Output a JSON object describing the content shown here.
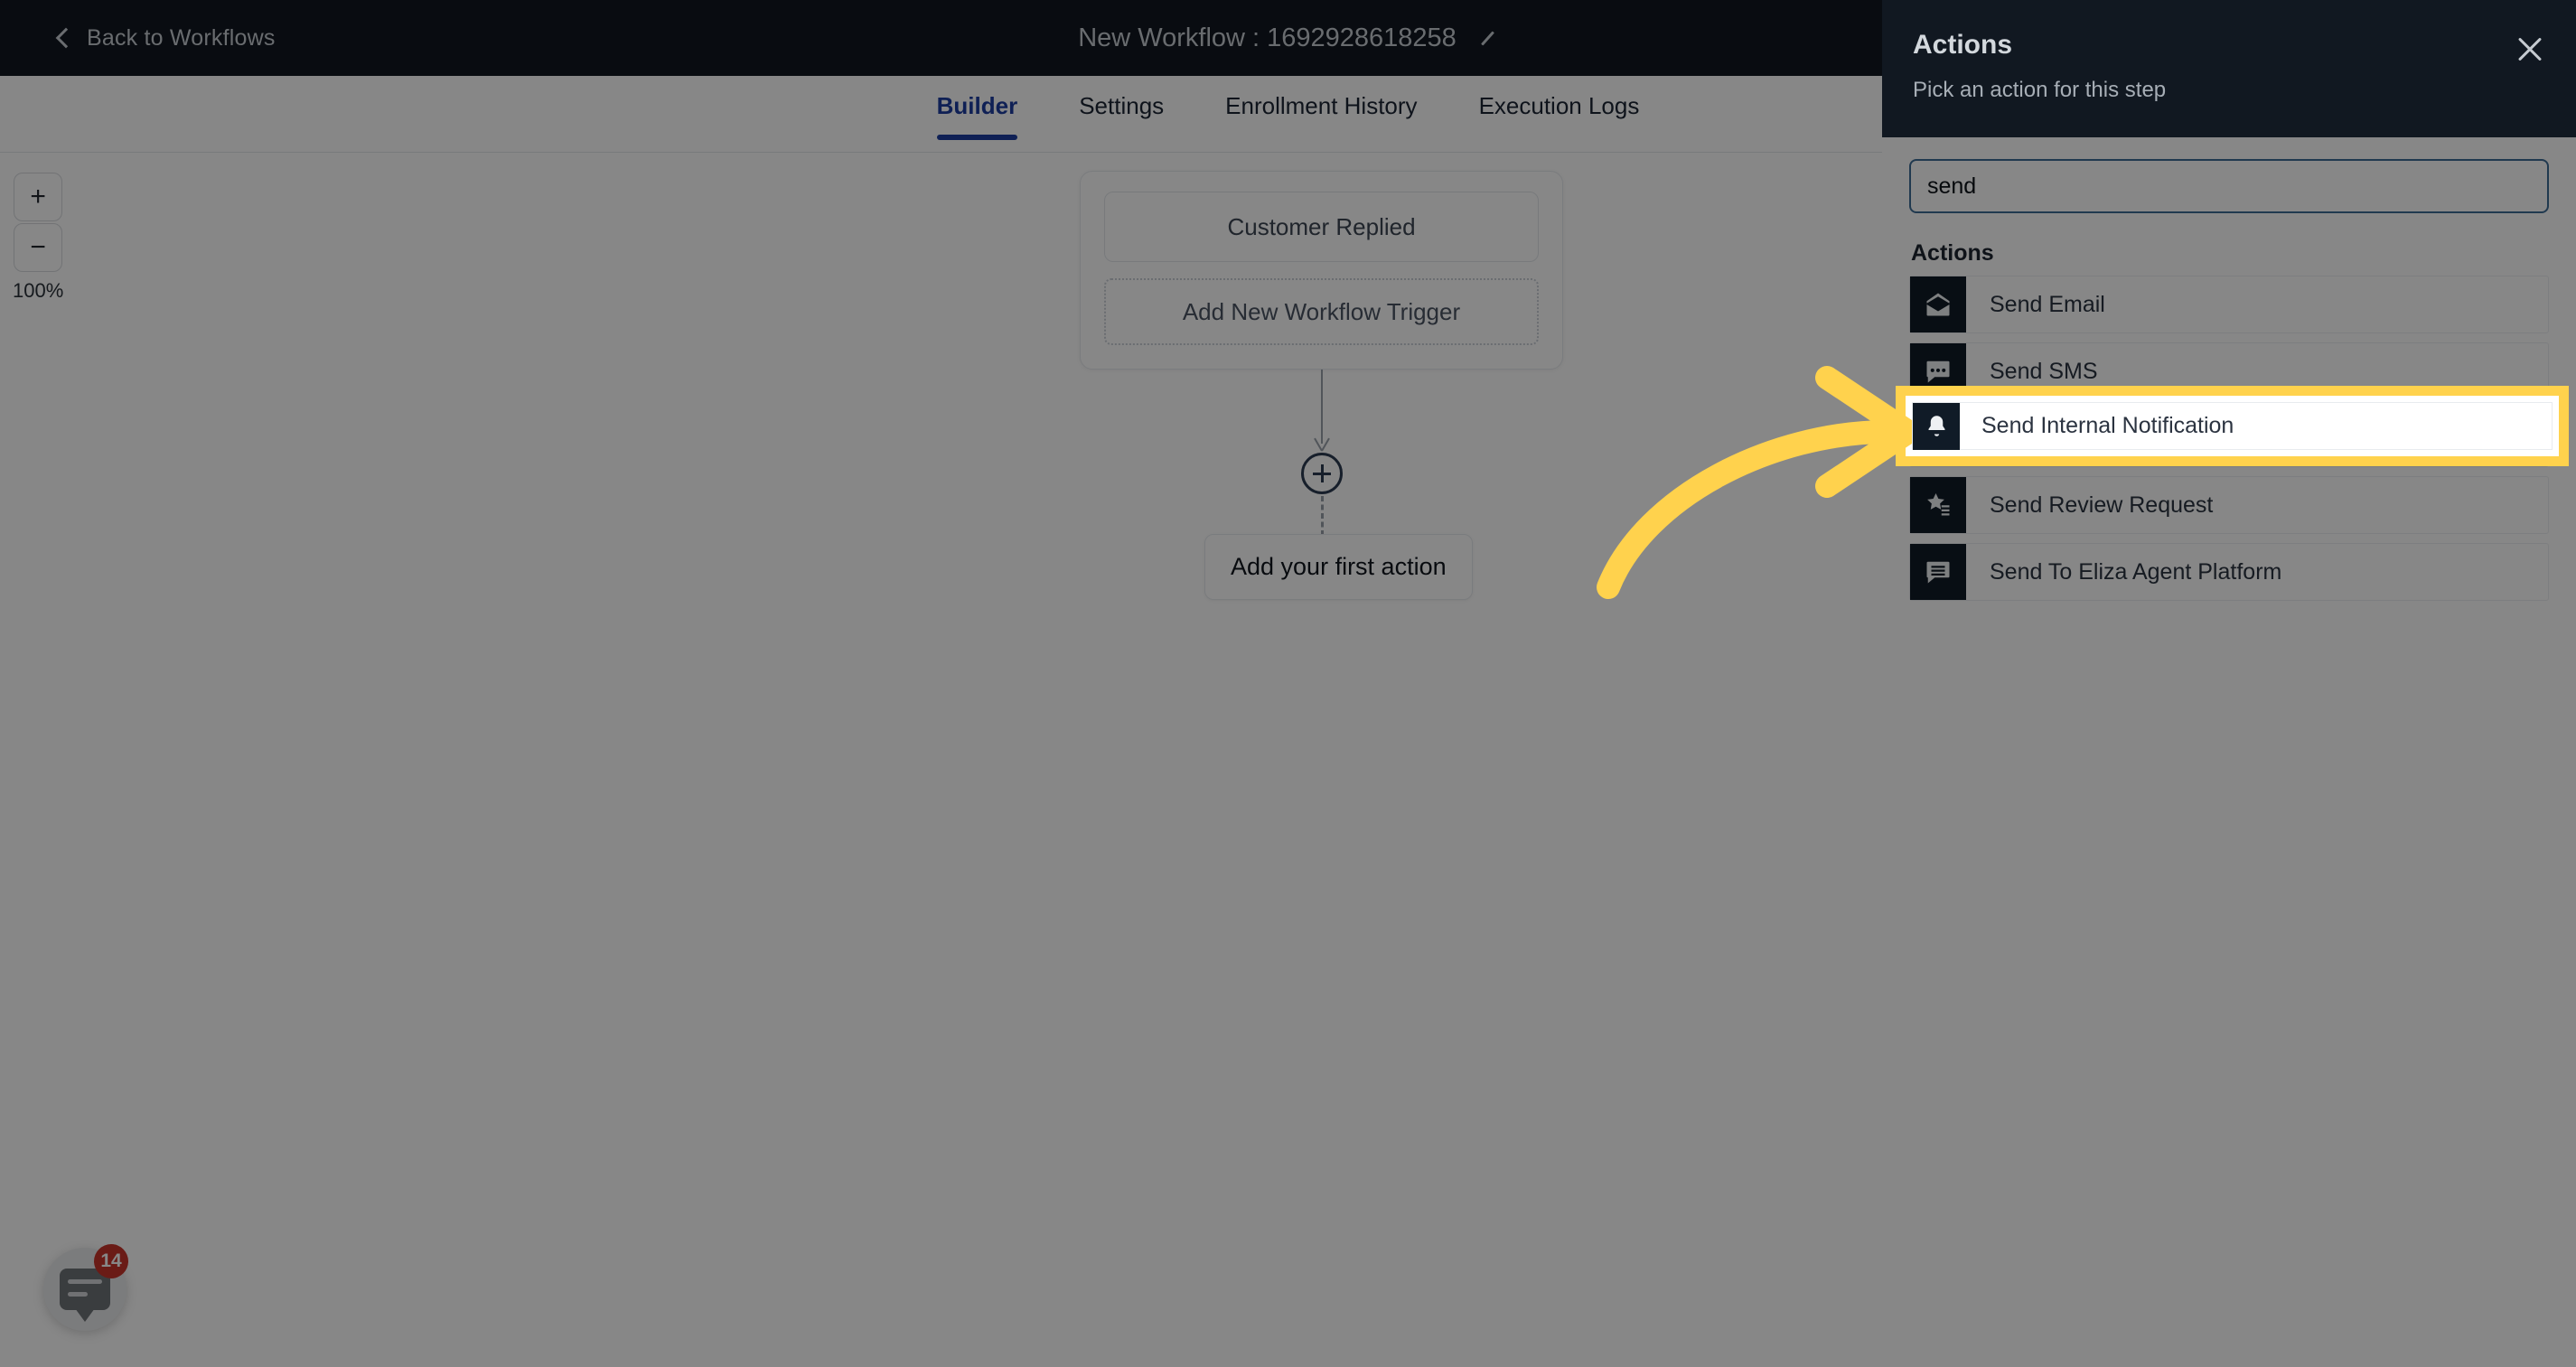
{
  "topbar": {
    "back_label": "Back to Workflows",
    "back_icon": "chevron-left-icon",
    "workflow_title": "New Workflow : 1692928618258",
    "edit_icon": "pencil-icon"
  },
  "tabs": [
    {
      "label": "Builder",
      "active": true
    },
    {
      "label": "Settings",
      "active": false
    },
    {
      "label": "Enrollment History",
      "active": false
    },
    {
      "label": "Execution Logs",
      "active": false
    }
  ],
  "canvas": {
    "zoom": {
      "in_label": "+",
      "out_label": "−",
      "level": "100%"
    },
    "trigger_card": {
      "trigger_label": "Customer Replied",
      "add_trigger_label": "Add New Workflow Trigger"
    },
    "add_node_icon": "plus-circle-icon",
    "first_action_label": "Add your first action",
    "chat_widget": {
      "icon": "chat-bubble-icon",
      "badge": "14"
    }
  },
  "panel": {
    "title": "Actions",
    "subtitle": "Pick an action for this step",
    "close_icon": "close-icon",
    "search": {
      "value": "send",
      "placeholder": "Search actions"
    },
    "list_header": "Actions",
    "items": [
      {
        "label": "Send Email",
        "icon": "envelope-open-icon",
        "highlighted": false
      },
      {
        "label": "Send SMS",
        "icon": "chat-dots-icon",
        "highlighted": false
      },
      {
        "label": "Send Internal Notification",
        "icon": "bell-icon",
        "highlighted": true
      },
      {
        "label": "Send Review Request",
        "icon": "star-list-icon",
        "highlighted": false
      },
      {
        "label": "Send To Eliza Agent Platform",
        "icon": "message-lines-icon",
        "highlighted": false
      }
    ]
  },
  "annotation": {
    "arrow_icon": "curved-arrow-right-icon",
    "highlight_color": "#ffd24d",
    "target_label": "Send Internal Notification"
  },
  "colors": {
    "topbar_bg": "#111821",
    "accent_blue": "#1d3ea0",
    "icon_tile": "#101b27",
    "highlight_yellow": "#ffd24d",
    "badge_red": "#c9342b",
    "overlay": "rgba(0,0,0,0.47)"
  }
}
